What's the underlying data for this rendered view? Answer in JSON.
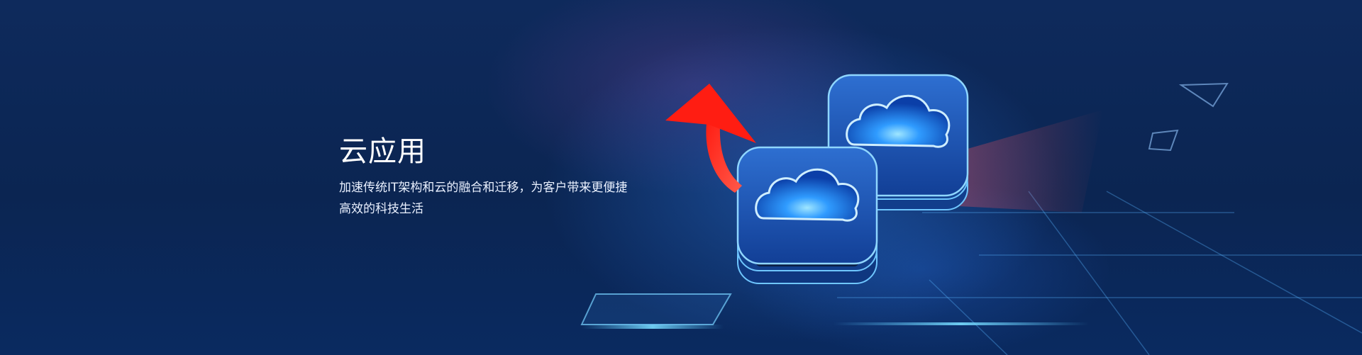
{
  "banner": {
    "title": "云应用",
    "description_line1": "加速传统IT架构和云的融合和迁移，为客户带来更便捷",
    "description_line2": "高效的科技生活"
  },
  "icons": {
    "front": "cloud-server-icon",
    "back": "cloud-server-icon",
    "arrow": "red-curved-arrow-icon"
  },
  "colors": {
    "background": "#0b2350",
    "accent": "#2f9bff",
    "arrow": "#ff2a1f",
    "text": "#ffffff"
  }
}
